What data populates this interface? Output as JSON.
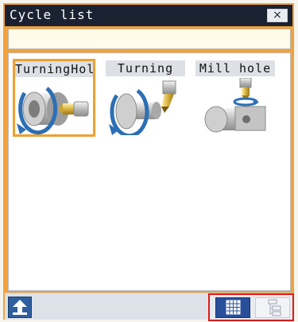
{
  "window": {
    "title": "Cycle list",
    "close_label": "×"
  },
  "input": {
    "value": ""
  },
  "cycles": [
    {
      "label": "TurningHol",
      "icon": "turning-hole-icon",
      "selected": true
    },
    {
      "label": "Turning",
      "icon": "turning-icon",
      "selected": false
    },
    {
      "label": "Mill hole",
      "icon": "mill-hole-icon",
      "selected": false
    }
  ],
  "toolbar": {
    "back_icon": "back-arrow-icon",
    "grid_view_icon": "grid-view-icon",
    "tree_view_icon": "tree-view-icon",
    "active_view": "grid"
  },
  "colors": {
    "title_bg": "#1a2130",
    "frame_accent": "#f2a23a",
    "selection": "#f0a030",
    "highlight_box": "#e01818",
    "active_button": "#2a4f9a"
  }
}
